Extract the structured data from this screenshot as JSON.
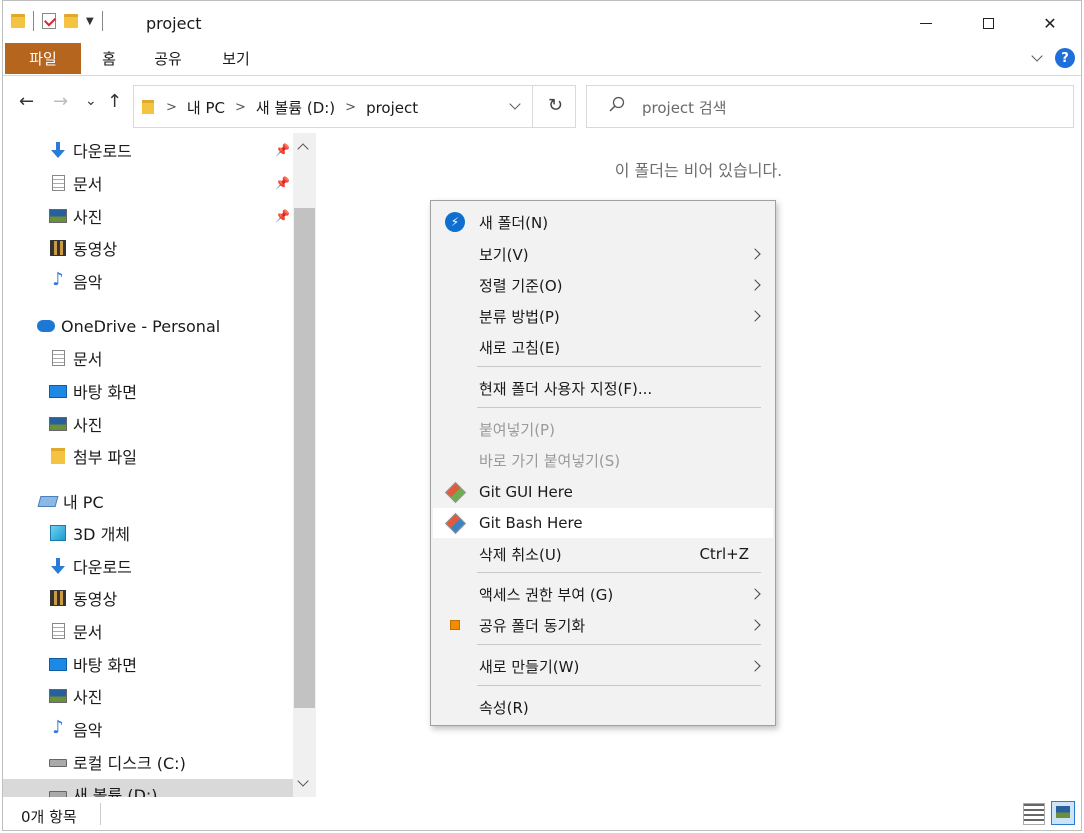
{
  "window": {
    "title": "project",
    "controls": {
      "minimize": "—",
      "maximize": "☐",
      "close": "✕"
    }
  },
  "ribbon": {
    "tabs": [
      "파일",
      "홈",
      "공유",
      "보기"
    ],
    "help_label": "?"
  },
  "navigation": {
    "back": "←",
    "forward": "→",
    "recent": "⌄",
    "up": "↑",
    "breadcrumbs": [
      "내 PC",
      "새 볼륨 (D:)",
      "project"
    ],
    "crumb_separator": ">",
    "refresh": "↻",
    "search_placeholder": "project 검색"
  },
  "nav_pane": {
    "quick_access": [
      {
        "label": "다운로드",
        "icon": "download-icon",
        "pinned": true
      },
      {
        "label": "문서",
        "icon": "document-icon",
        "pinned": true
      },
      {
        "label": "사진",
        "icon": "pictures-icon",
        "pinned": true
      },
      {
        "label": "동영상",
        "icon": "video-icon",
        "pinned": false
      },
      {
        "label": "음악",
        "icon": "music-icon",
        "pinned": false
      }
    ],
    "onedrive": {
      "label": "OneDrive - Personal",
      "items": [
        "문서",
        "바탕 화면",
        "사진",
        "첨부 파일"
      ]
    },
    "this_pc": {
      "label": "내 PC",
      "items": [
        "3D 개체",
        "다운로드",
        "동영상",
        "문서",
        "바탕 화면",
        "사진",
        "음악",
        "로컬 디스크 (C:)",
        "새 볼륨 (D:)"
      ]
    },
    "pin_glyph": "📌"
  },
  "content": {
    "empty_message": "이 폴더는 비어 있습니다."
  },
  "context_menu": {
    "items": [
      {
        "label": "새 폴더(N)",
        "icon": "new-folder-icon"
      },
      {
        "label": "보기(V)",
        "submenu": true
      },
      {
        "label": "정렬 기준(O)",
        "submenu": true
      },
      {
        "label": "분류 방법(P)",
        "submenu": true
      },
      {
        "label": "새로 고침(E)"
      },
      {
        "label": "현재 폴더 사용자 지정(F)..."
      },
      {
        "label": "붙여넣기(P)",
        "disabled": true
      },
      {
        "label": "바로 가기 붙여넣기(S)",
        "disabled": true
      },
      {
        "label": "Git GUI Here",
        "icon": "git-gui-icon"
      },
      {
        "label": "Git Bash Here",
        "icon": "git-bash-icon",
        "highlighted": true
      },
      {
        "label": "삭제 취소(U)",
        "shortcut": "Ctrl+Z"
      },
      {
        "label": "액세스 권한 부여 (G)",
        "submenu": true
      },
      {
        "label": "공유 폴더 동기화",
        "icon": "sync-icon",
        "submenu": true
      },
      {
        "label": "새로 만들기(W)",
        "submenu": true
      },
      {
        "label": "속성(R)"
      }
    ]
  },
  "status_bar": {
    "item_count": "0개 항목"
  }
}
